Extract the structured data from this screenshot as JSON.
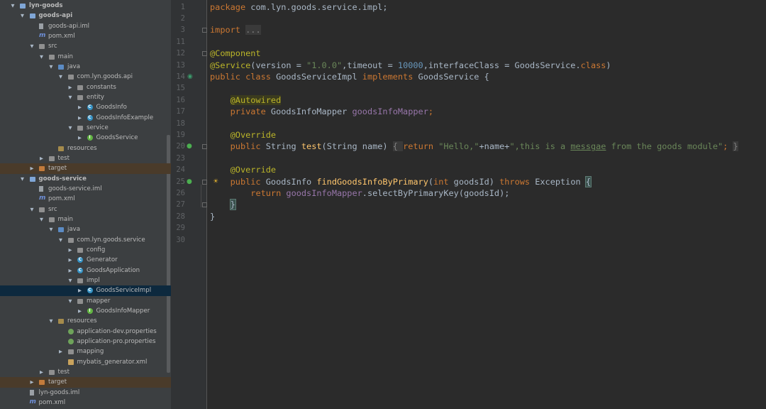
{
  "project_tree": {
    "items": [
      {
        "label": "lyn-goods",
        "depth": 0,
        "arrow": "down",
        "icon": "module-folder",
        "bold": true
      },
      {
        "label": "goods-api",
        "depth": 1,
        "arrow": "down",
        "icon": "module-folder",
        "bold": true
      },
      {
        "label": "goods-api.iml",
        "depth": 2,
        "arrow": "",
        "icon": "iml-file"
      },
      {
        "label": "pom.xml",
        "depth": 2,
        "arrow": "",
        "icon": "maven-file"
      },
      {
        "label": "src",
        "depth": 2,
        "arrow": "down",
        "icon": "folder"
      },
      {
        "label": "main",
        "depth": 3,
        "arrow": "down",
        "icon": "folder"
      },
      {
        "label": "java",
        "depth": 4,
        "arrow": "down",
        "icon": "source-folder"
      },
      {
        "label": "com.lyn.goods.api",
        "depth": 5,
        "arrow": "down",
        "icon": "package"
      },
      {
        "label": "constants",
        "depth": 6,
        "arrow": "right",
        "icon": "package"
      },
      {
        "label": "entity",
        "depth": 6,
        "arrow": "down",
        "icon": "package"
      },
      {
        "label": "GoodsInfo",
        "depth": 7,
        "arrow": "right",
        "icon": "class"
      },
      {
        "label": "GoodsInfoExample",
        "depth": 7,
        "arrow": "right",
        "icon": "class"
      },
      {
        "label": "service",
        "depth": 6,
        "arrow": "down",
        "icon": "package"
      },
      {
        "label": "GoodsService",
        "depth": 7,
        "arrow": "right",
        "icon": "interface"
      },
      {
        "label": "resources",
        "depth": 4,
        "arrow": "",
        "icon": "resources-folder"
      },
      {
        "label": "test",
        "depth": 3,
        "arrow": "right",
        "icon": "folder"
      },
      {
        "label": "target",
        "depth": 2,
        "arrow": "right",
        "icon": "excluded-folder",
        "excluded": true
      },
      {
        "label": "goods-service",
        "depth": 1,
        "arrow": "down",
        "icon": "module-folder",
        "bold": true
      },
      {
        "label": "goods-service.iml",
        "depth": 2,
        "arrow": "",
        "icon": "iml-file"
      },
      {
        "label": "pom.xml",
        "depth": 2,
        "arrow": "",
        "icon": "maven-file"
      },
      {
        "label": "src",
        "depth": 2,
        "arrow": "down",
        "icon": "folder"
      },
      {
        "label": "main",
        "depth": 3,
        "arrow": "down",
        "icon": "folder"
      },
      {
        "label": "java",
        "depth": 4,
        "arrow": "down",
        "icon": "source-folder"
      },
      {
        "label": "com.lyn.goods.service",
        "depth": 5,
        "arrow": "down",
        "icon": "package"
      },
      {
        "label": "config",
        "depth": 6,
        "arrow": "right",
        "icon": "package"
      },
      {
        "label": "Generator",
        "depth": 6,
        "arrow": "right",
        "icon": "class"
      },
      {
        "label": "GoodsApplication",
        "depth": 6,
        "arrow": "right",
        "icon": "class"
      },
      {
        "label": "impl",
        "depth": 6,
        "arrow": "down",
        "icon": "package"
      },
      {
        "label": "GoodsServiceImpl",
        "depth": 7,
        "arrow": "right",
        "icon": "class",
        "selected": true
      },
      {
        "label": "mapper",
        "depth": 6,
        "arrow": "down",
        "icon": "package"
      },
      {
        "label": "GoodsInfoMapper",
        "depth": 7,
        "arrow": "right",
        "icon": "interface"
      },
      {
        "label": "resources",
        "depth": 4,
        "arrow": "down",
        "icon": "resources-folder"
      },
      {
        "label": "application-dev.properties",
        "depth": 5,
        "arrow": "",
        "icon": "properties-file"
      },
      {
        "label": "application-pro.properties",
        "depth": 5,
        "arrow": "",
        "icon": "properties-file"
      },
      {
        "label": "mapping",
        "depth": 5,
        "arrow": "right",
        "icon": "folder"
      },
      {
        "label": "mybatis_generator.xml",
        "depth": 5,
        "arrow": "",
        "icon": "xml-file"
      },
      {
        "label": "test",
        "depth": 3,
        "arrow": "right",
        "icon": "folder"
      },
      {
        "label": "target",
        "depth": 2,
        "arrow": "right",
        "icon": "excluded-folder",
        "excluded": true
      },
      {
        "label": "lyn-goods.iml",
        "depth": 1,
        "arrow": "",
        "icon": "iml-file"
      },
      {
        "label": "pom.xml",
        "depth": 1,
        "arrow": "",
        "icon": "maven-file"
      }
    ]
  },
  "editor": {
    "line_numbers": [
      "1",
      "2",
      "3",
      "11",
      "12",
      "13",
      "14",
      "15",
      "16",
      "17",
      "18",
      "19",
      "20",
      "23",
      "24",
      "25",
      "26",
      "27",
      "28",
      "29",
      "30"
    ],
    "lines": [
      [
        [
          "kw",
          "package "
        ],
        [
          "t",
          "com.lyn.goods.service.impl;"
        ]
      ],
      [],
      [
        [
          "kw",
          "import "
        ],
        [
          "fold",
          "..."
        ]
      ],
      [],
      [
        [
          "ann",
          "@Component"
        ]
      ],
      [
        [
          "ann",
          "@Service"
        ],
        [
          "t",
          "(version = "
        ],
        [
          "str",
          "\"1.0.0\""
        ],
        [
          "t",
          ",timeout = "
        ],
        [
          "num",
          "10000"
        ],
        [
          "t",
          ",interfaceClass = GoodsService."
        ],
        [
          "kw",
          "class"
        ],
        [
          "t",
          ")"
        ]
      ],
      [
        [
          "kw",
          "public class "
        ],
        [
          "t",
          "GoodsServiceImpl "
        ],
        [
          "kw",
          "implements "
        ],
        [
          "t",
          "GoodsService {"
        ]
      ],
      [],
      [
        [
          "t",
          "    "
        ],
        [
          "ann-hl",
          "@Autowired"
        ]
      ],
      [
        [
          "t",
          "    "
        ],
        [
          "kw",
          "private "
        ],
        [
          "t",
          "GoodsInfoMapper "
        ],
        [
          "fld",
          "goodsInfoMapper"
        ],
        [
          "kw",
          ";"
        ]
      ],
      [],
      [
        [
          "t",
          "    "
        ],
        [
          "ann",
          "@Override"
        ]
      ],
      [
        [
          "t",
          "    "
        ],
        [
          "kw",
          "public "
        ],
        [
          "t",
          "String "
        ],
        [
          "meth",
          "test"
        ],
        [
          "t",
          "(String name) "
        ],
        [
          "fold",
          "{ "
        ],
        [
          "kw",
          "return "
        ],
        [
          "str",
          "\"Hello,\""
        ],
        [
          "t",
          "+name+"
        ],
        [
          "str",
          "\",this is a "
        ],
        [
          "str-typo",
          "messgae"
        ],
        [
          "str",
          " from the goods module\""
        ],
        [
          "kw",
          "; "
        ],
        [
          "fold",
          "}"
        ]
      ],
      [],
      [
        [
          "t",
          "    "
        ],
        [
          "ann",
          "@Override"
        ]
      ],
      [
        [
          "t",
          "    "
        ],
        [
          "kw",
          "public "
        ],
        [
          "t",
          "GoodsInfo "
        ],
        [
          "meth",
          "findGoodsInfoByPrimary"
        ],
        [
          "t",
          "("
        ],
        [
          "kw",
          "int "
        ],
        [
          "t",
          "goodsId) "
        ],
        [
          "kw",
          "throws "
        ],
        [
          "t",
          "Exception "
        ],
        [
          "brace",
          "{"
        ]
      ],
      [
        [
          "t",
          "        "
        ],
        [
          "kw",
          "return "
        ],
        [
          "fld",
          "goodsInfoMapper"
        ],
        [
          "t",
          ".selectByPrimaryKey(goodsId);"
        ]
      ],
      [
        [
          "t",
          "    "
        ],
        [
          "brace",
          "}"
        ]
      ],
      [
        [
          "t",
          "}"
        ]
      ],
      [],
      []
    ]
  },
  "colors": {
    "background": "#2b2b2b",
    "sidebar": "#3c3f41",
    "selection": "#0d293e",
    "keyword": "#cc7832",
    "string": "#6a8759",
    "annotation": "#bbb529",
    "field": "#9876aa",
    "method": "#ffc66d"
  }
}
